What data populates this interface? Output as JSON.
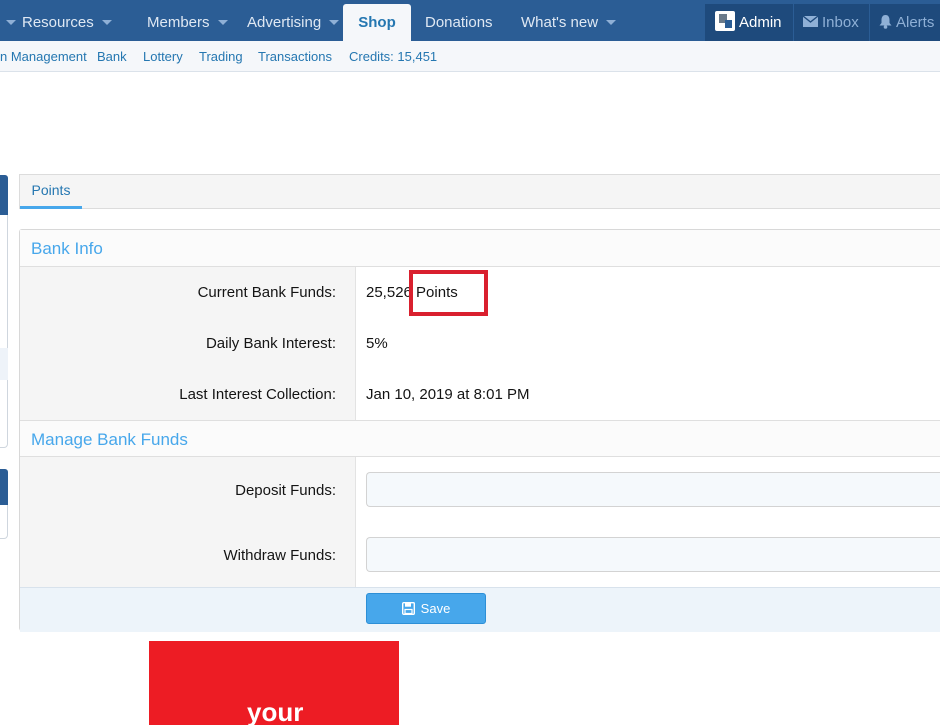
{
  "topnav": {
    "items": [
      {
        "label": "Resources"
      },
      {
        "label": "Members"
      },
      {
        "label": "Advertising"
      },
      {
        "label": "Shop"
      },
      {
        "label": "Donations"
      },
      {
        "label": "What's new"
      }
    ],
    "user": {
      "admin": "Admin",
      "inbox": "Inbox",
      "alerts": "Alerts"
    }
  },
  "subnav": {
    "items": [
      "n Management",
      "Bank",
      "Lottery",
      "Trading",
      "Transactions"
    ],
    "credits": "Credits: 15,451"
  },
  "tabs": {
    "points": "Points"
  },
  "bank_info": {
    "title": "Bank Info",
    "rows": [
      {
        "label": "Current Bank Funds:",
        "value": "25,526 Points"
      },
      {
        "label": "Daily Bank Interest:",
        "value": "5%"
      },
      {
        "label": "Last Interest Collection:",
        "value": "Jan 10, 2019 at 8:01 PM"
      }
    ]
  },
  "manage": {
    "title": "Manage Bank Funds",
    "deposit_label": "Deposit Funds:",
    "withdraw_label": "Withdraw Funds:",
    "deposit_value": "",
    "withdraw_value": ""
  },
  "save_label": "Save",
  "ad_text": "your",
  "colors": {
    "nav": "#2b5d95",
    "accent": "#47a7eb",
    "highlight": "#d9202e",
    "ad": "#ed1c24"
  }
}
